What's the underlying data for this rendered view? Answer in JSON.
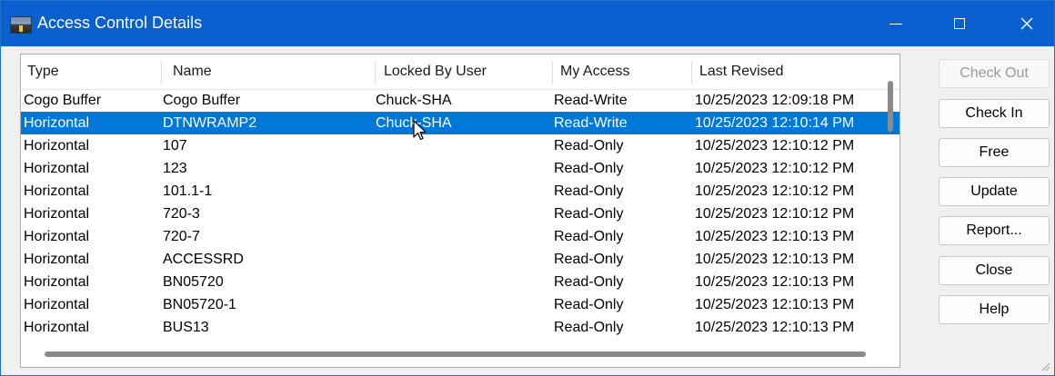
{
  "window": {
    "title": "Access Control Details"
  },
  "list": {
    "columns": [
      "Type",
      "Name",
      "Locked By User",
      "My Access",
      "Last Revised"
    ],
    "selected_index": 1,
    "rows": [
      {
        "type": "Cogo Buffer",
        "name": "Cogo Buffer",
        "locked_by": "Chuck-SHA",
        "access": "Read-Write",
        "revised": "10/25/2023 12:09:18 PM"
      },
      {
        "type": "Horizontal",
        "name": "DTNWRAMP2",
        "locked_by": "Chuck-SHA",
        "access": "Read-Write",
        "revised": "10/25/2023 12:10:14 PM"
      },
      {
        "type": "Horizontal",
        "name": "107",
        "locked_by": "",
        "access": "Read-Only",
        "revised": "10/25/2023 12:10:12 PM"
      },
      {
        "type": "Horizontal",
        "name": "123",
        "locked_by": "",
        "access": "Read-Only",
        "revised": "10/25/2023 12:10:12 PM"
      },
      {
        "type": "Horizontal",
        "name": "101.1-1",
        "locked_by": "",
        "access": "Read-Only",
        "revised": "10/25/2023 12:10:12 PM"
      },
      {
        "type": "Horizontal",
        "name": "720-3",
        "locked_by": "",
        "access": "Read-Only",
        "revised": "10/25/2023 12:10:12 PM"
      },
      {
        "type": "Horizontal",
        "name": "720-7",
        "locked_by": "",
        "access": "Read-Only",
        "revised": "10/25/2023 12:10:13 PM"
      },
      {
        "type": "Horizontal",
        "name": "ACCESSRD",
        "locked_by": "",
        "access": "Read-Only",
        "revised": "10/25/2023 12:10:13 PM"
      },
      {
        "type": "Horizontal",
        "name": "BN05720",
        "locked_by": "",
        "access": "Read-Only",
        "revised": "10/25/2023 12:10:13 PM"
      },
      {
        "type": "Horizontal",
        "name": "BN05720-1",
        "locked_by": "",
        "access": "Read-Only",
        "revised": "10/25/2023 12:10:13 PM"
      },
      {
        "type": "Horizontal",
        "name": "BUS13",
        "locked_by": "",
        "access": "Read-Only",
        "revised": "10/25/2023 12:10:13 PM"
      }
    ]
  },
  "buttons": {
    "check_out": "Check Out",
    "check_in": "Check In",
    "free": "Free",
    "update": "Update",
    "report": "Report...",
    "close": "Close",
    "help": "Help"
  },
  "colors": {
    "titlebar": "#0a5fce",
    "selection": "#0078d7"
  }
}
